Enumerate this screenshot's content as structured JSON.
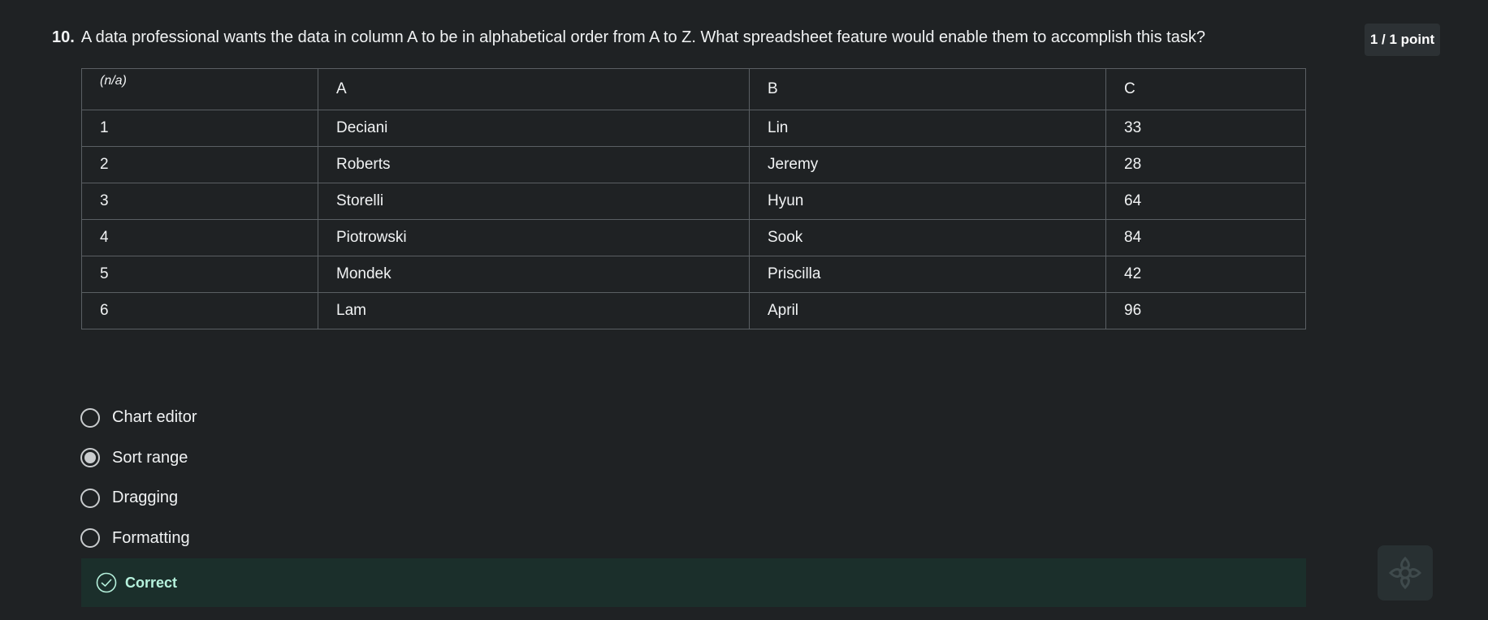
{
  "question": {
    "number": "10.",
    "text": "A data professional wants the data in column A to be in alphabetical order from A to Z. What spreadsheet feature would enable them to accomplish this task?",
    "points": "1 / 1 point"
  },
  "table": {
    "headers": [
      "(n/a)",
      "A",
      "B",
      "C"
    ],
    "rows": [
      [
        "1",
        "Deciani",
        "Lin",
        "33"
      ],
      [
        "2",
        "Roberts",
        "Jeremy",
        "28"
      ],
      [
        "3",
        "Storelli",
        "Hyun",
        "64"
      ],
      [
        "4",
        "Piotrowski",
        "Sook",
        "84"
      ],
      [
        "5",
        "Mondek",
        "Priscilla",
        "42"
      ],
      [
        "6",
        "Lam",
        "April",
        "96"
      ]
    ]
  },
  "options": [
    {
      "label": "Chart editor",
      "selected": false
    },
    {
      "label": "Sort range",
      "selected": true
    },
    {
      "label": "Dragging",
      "selected": false
    },
    {
      "label": "Formatting",
      "selected": false
    }
  ],
  "feedback": {
    "label": "Correct",
    "icon": "check-circle-icon",
    "color": "#b6f2dd"
  },
  "assistant": {
    "icon": "ai-assistant-icon"
  }
}
